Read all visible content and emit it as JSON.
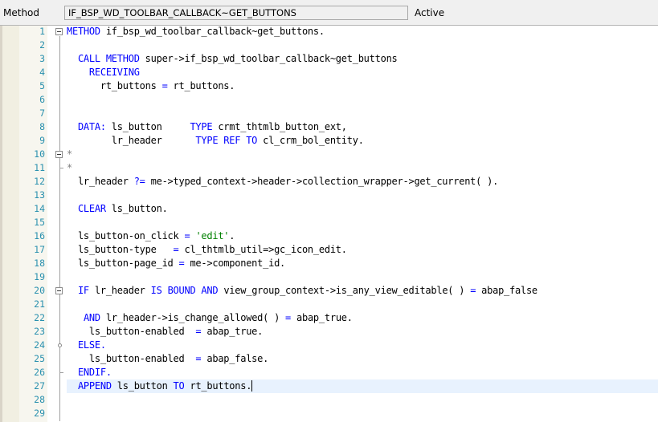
{
  "header": {
    "method_label": "Method",
    "method_value": "IF_BSP_WD_TOOLBAR_CALLBACK~GET_BUTTONS",
    "status": "Active"
  },
  "editor": {
    "current_line": 27,
    "lines": [
      {
        "n": "1",
        "fold": "open",
        "tokens": [
          [
            "kw",
            "METHOD"
          ],
          [
            "t",
            " if_bsp_wd_toolbar_callback~get_buttons."
          ]
        ]
      },
      {
        "n": "2",
        "fold": "line",
        "tokens": []
      },
      {
        "n": "3",
        "fold": "line",
        "tokens": [
          [
            "t",
            "  "
          ],
          [
            "kw",
            "CALL METHOD"
          ],
          [
            "t",
            " super->if_bsp_wd_toolbar_callback~get_buttons"
          ]
        ]
      },
      {
        "n": "4",
        "fold": "line",
        "tokens": [
          [
            "t",
            "    "
          ],
          [
            "kw",
            "RECEIVING"
          ]
        ]
      },
      {
        "n": "5",
        "fold": "line",
        "tokens": [
          [
            "t",
            "      rt_buttons "
          ],
          [
            "op",
            "="
          ],
          [
            "t",
            " rt_buttons."
          ]
        ]
      },
      {
        "n": "6",
        "fold": "line",
        "tokens": []
      },
      {
        "n": "7",
        "fold": "line",
        "tokens": []
      },
      {
        "n": "8",
        "fold": "line",
        "tokens": [
          [
            "t",
            "  "
          ],
          [
            "kw",
            "DATA:"
          ],
          [
            "t",
            " ls_button     "
          ],
          [
            "kw",
            "TYPE"
          ],
          [
            "t",
            " crmt_thtmlb_button_ext,"
          ]
        ]
      },
      {
        "n": "9",
        "fold": "line",
        "tokens": [
          [
            "t",
            "        lr_header      "
          ],
          [
            "kw",
            "TYPE REF TO"
          ],
          [
            "t",
            " cl_crm_bol_entity."
          ]
        ]
      },
      {
        "n": "10",
        "fold": "open",
        "tokens": [
          [
            "cmt",
            "*"
          ]
        ]
      },
      {
        "n": "11",
        "fold": "end",
        "tokens": [
          [
            "cmt",
            "*"
          ]
        ]
      },
      {
        "n": "12",
        "fold": "line",
        "tokens": [
          [
            "t",
            "  lr_header "
          ],
          [
            "op",
            "?="
          ],
          [
            "t",
            " me->typed_context->header->collection_wrapper->get_current( )."
          ]
        ]
      },
      {
        "n": "13",
        "fold": "line",
        "tokens": []
      },
      {
        "n": "14",
        "fold": "line",
        "tokens": [
          [
            "t",
            "  "
          ],
          [
            "kw",
            "CLEAR"
          ],
          [
            "t",
            " ls_button."
          ]
        ]
      },
      {
        "n": "15",
        "fold": "line",
        "tokens": []
      },
      {
        "n": "16",
        "fold": "line",
        "tokens": [
          [
            "t",
            "  ls_button-on_click "
          ],
          [
            "op",
            "="
          ],
          [
            "t",
            " "
          ],
          [
            "str",
            "'edit'"
          ],
          [
            "t",
            "."
          ]
        ]
      },
      {
        "n": "17",
        "fold": "line",
        "tokens": [
          [
            "t",
            "  ls_button-type   "
          ],
          [
            "op",
            "="
          ],
          [
            "t",
            " cl_thtmlb_util=>gc_icon_edit."
          ]
        ]
      },
      {
        "n": "18",
        "fold": "line",
        "tokens": [
          [
            "t",
            "  ls_button-page_id "
          ],
          [
            "op",
            "="
          ],
          [
            "t",
            " me->component_id."
          ]
        ]
      },
      {
        "n": "19",
        "fold": "line",
        "tokens": []
      },
      {
        "n": "20",
        "fold": "open",
        "tokens": [
          [
            "t",
            "  "
          ],
          [
            "kw",
            "IF"
          ],
          [
            "t",
            " lr_header "
          ],
          [
            "kw",
            "IS BOUND AND"
          ],
          [
            "t",
            " view_group_context->is_any_view_editable( ) "
          ],
          [
            "op",
            "="
          ],
          [
            "t",
            " abap_false"
          ]
        ]
      },
      {
        "n": "21",
        "fold": "line",
        "tokens": []
      },
      {
        "n": "22",
        "fold": "line",
        "tokens": [
          [
            "t",
            "   "
          ],
          [
            "kw",
            "AND"
          ],
          [
            "t",
            " lr_header->is_change_allowed( ) "
          ],
          [
            "op",
            "="
          ],
          [
            "t",
            " abap_true."
          ]
        ]
      },
      {
        "n": "23",
        "fold": "line",
        "tokens": [
          [
            "t",
            "    ls_button-enabled  "
          ],
          [
            "op",
            "="
          ],
          [
            "t",
            " abap_true."
          ]
        ]
      },
      {
        "n": "24",
        "fold": "mid",
        "tokens": [
          [
            "t",
            "  "
          ],
          [
            "kw",
            "ELSE."
          ]
        ]
      },
      {
        "n": "25",
        "fold": "line",
        "tokens": [
          [
            "t",
            "    ls_button-enabled  "
          ],
          [
            "op",
            "="
          ],
          [
            "t",
            " abap_false."
          ]
        ]
      },
      {
        "n": "26",
        "fold": "end",
        "tokens": [
          [
            "t",
            "  "
          ],
          [
            "kw",
            "ENDIF."
          ]
        ]
      },
      {
        "n": "27",
        "fold": "line",
        "tokens": [
          [
            "t",
            "  "
          ],
          [
            "kw",
            "APPEND"
          ],
          [
            "t",
            " ls_button "
          ],
          [
            "kw",
            "TO"
          ],
          [
            "t",
            " rt_buttons."
          ]
        ]
      },
      {
        "n": "28",
        "fold": "line",
        "tokens": []
      },
      {
        "n": "29",
        "fold": "line",
        "tokens": []
      }
    ]
  }
}
